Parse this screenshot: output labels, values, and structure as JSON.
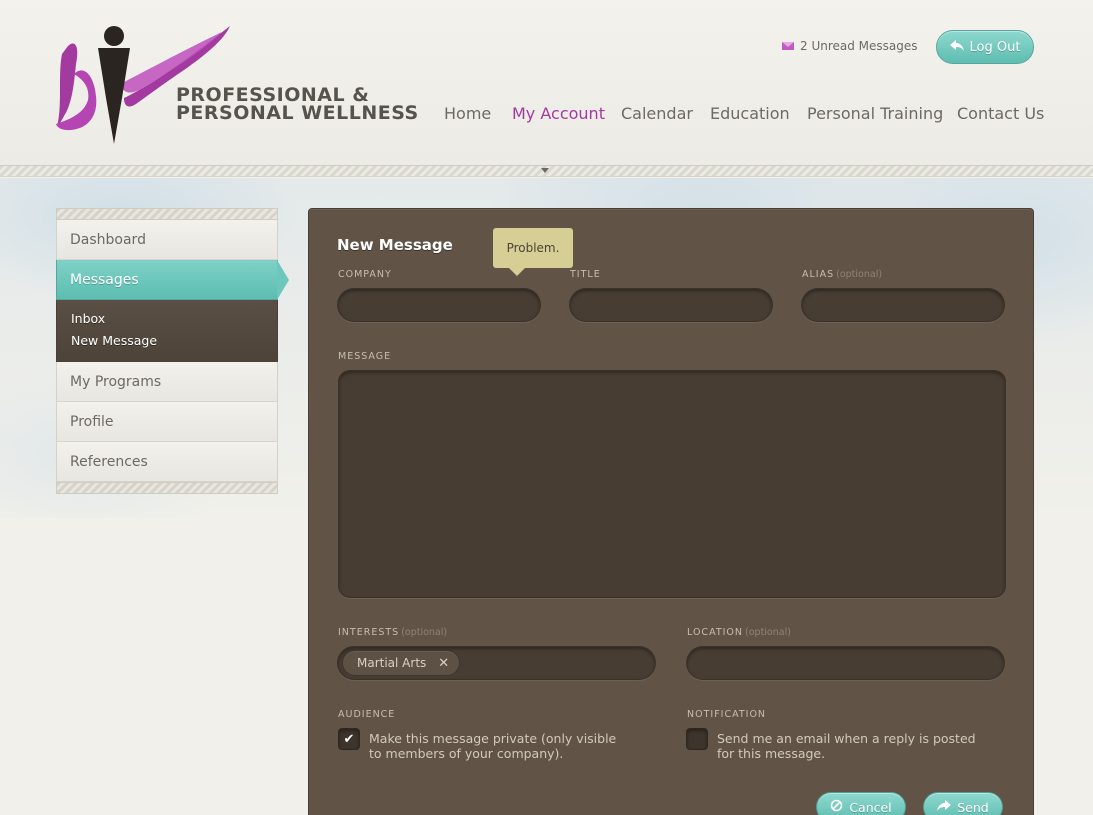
{
  "brand": {
    "line1": "PROFESSIONAL &",
    "line2": "PERSONAL WELLNESS",
    "accent_color": "#a33aa0"
  },
  "header": {
    "unread_messages": "2 Unread Messages",
    "logout_label": "Log Out"
  },
  "nav": {
    "items": [
      {
        "label": "Home"
      },
      {
        "label": "My Account"
      },
      {
        "label": "Calendar"
      },
      {
        "label": "Education"
      },
      {
        "label": "Personal Training"
      },
      {
        "label": "Contact Us"
      }
    ],
    "active": "My Account"
  },
  "sidebar": {
    "items": [
      {
        "label": "Dashboard"
      },
      {
        "label": "Messages"
      },
      {
        "label": "My Programs"
      },
      {
        "label": "Profile"
      },
      {
        "label": "References"
      }
    ],
    "active": "Messages",
    "subitems": [
      {
        "label": "Inbox"
      },
      {
        "label": "New Message"
      }
    ]
  },
  "form": {
    "title": "New Message",
    "tooltip": "Problem.",
    "company_label": "COMPANY",
    "title_label": "TITLE",
    "alias_label": "ALIAS",
    "alias_optional": "(optional)",
    "message_label": "MESSAGE",
    "interests_label": "INTERESTS",
    "interests_optional": "(optional)",
    "interests_tags": [
      "Martial Arts"
    ],
    "location_label": "LOCATION",
    "location_optional": "(optional)",
    "audience_label": "AUDIENCE",
    "audience_text": "Make this message private (only visible to members of your company).",
    "audience_checked": true,
    "notification_label": "NOTIFICATION",
    "notification_text": "Send me an email when a reply is posted for this message.",
    "notification_checked": false,
    "cancel_label": "Cancel",
    "send_label": "Send"
  },
  "colors": {
    "teal": "#5fbdb1",
    "panel": "#615447",
    "tooltip": "#d6ce95"
  }
}
